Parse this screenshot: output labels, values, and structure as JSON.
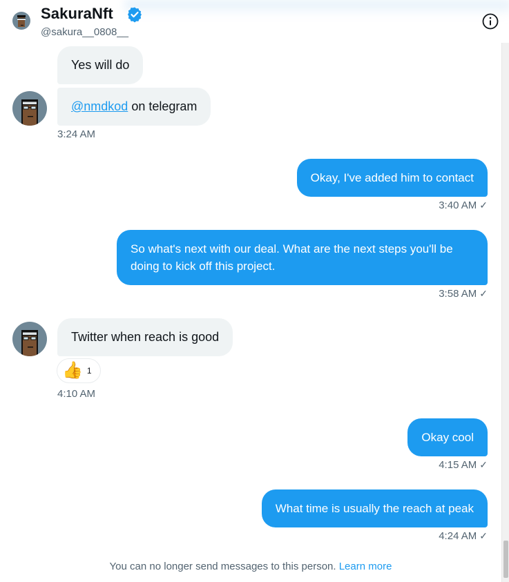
{
  "header": {
    "name": "SakuraNft",
    "handle": "@sakura__0808__"
  },
  "colors": {
    "accent": "#1d9bf0",
    "incoming_bubble": "#eff3f4",
    "muted_text": "#536471"
  },
  "icons": {
    "verified": "verified-badge-icon",
    "info": "info-icon",
    "read_receipt": "checkmark-icon",
    "reaction": "thumbs-up-emoji"
  },
  "messages": [
    {
      "direction": "in",
      "text": "Yes will do"
    },
    {
      "direction": "in",
      "mention": "@nmdkod",
      "text_after": " on telegram",
      "time": "3:24 AM"
    },
    {
      "direction": "out",
      "text": "Okay, I've added him to contact",
      "time": "3:40 AM"
    },
    {
      "direction": "out",
      "text": "So what's next with our deal. What are the next steps you'll be doing to kick off this project.",
      "time": "3:58 AM"
    },
    {
      "direction": "in",
      "text": "Twitter when reach is good",
      "time": "4:10 AM",
      "reaction": {
        "emoji": "👍",
        "count": "1"
      }
    },
    {
      "direction": "out",
      "text": "Okay cool",
      "time": "4:15 AM"
    },
    {
      "direction": "out",
      "text": "What time is usually the reach at peak",
      "time": "4:24 AM"
    }
  ],
  "check_glyph": "✓",
  "footer": {
    "notice": "You can no longer send messages to this person.",
    "link": "Learn more"
  }
}
